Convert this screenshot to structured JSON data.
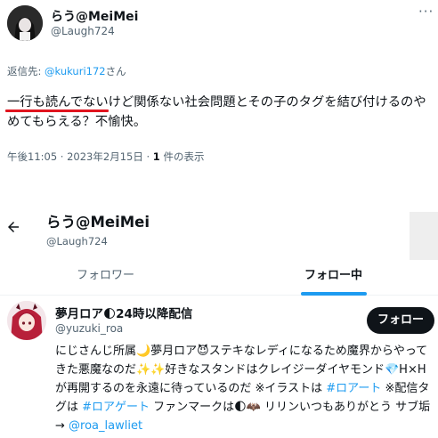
{
  "tweet": {
    "display_name": "らう@MeiMei",
    "handle": "@Laugh724",
    "more_icon": "more-dots-icon",
    "reply_prefix": "返信先: ",
    "reply_mention": "@kukuri172",
    "reply_suffix": "さん",
    "body_line1": "一行も読んでないけど関係ない社会問題とその子のタグを結び付けるのや",
    "body_line2": "めてもらえる？不愉快。",
    "time_date": "午後11:05 · 2023年2月15日 · ",
    "views_count": "1",
    "views_label": " 件の表示"
  },
  "profile": {
    "back_icon": "back-arrow-icon",
    "display_name": "らう@MeiMei",
    "handle": "@Laugh724"
  },
  "tabs": {
    "followers": "フォロワー",
    "following": "フォロー中"
  },
  "user_card": {
    "display_name": "夢月ロア🌓24時以降配信",
    "handle": "@yuzuki_roa",
    "follow_label": "フォロー",
    "bio_part1": "にじさんじ所属🌙夢月ロア😈ステキなレディになるため魔界からやってきた悪魔なのだ✨✨好きなスタンドはクレイジーダイヤモンド💎H×Hが再開するのを永遠に待っているのだ ※イラストは ",
    "bio_link1": "#ロアート",
    "bio_part2": " ※配信タグは ",
    "bio_link2": "#ロアゲート",
    "bio_part3": " ファンマークは🌓🦇 リリンいつもありがとう サブ垢→ ",
    "bio_link3": "@roa_lawliet"
  },
  "colors": {
    "accent": "#1d9bf0",
    "text": "#0f1419",
    "secondary": "#536471",
    "highlight_underline": "#e0141e"
  }
}
